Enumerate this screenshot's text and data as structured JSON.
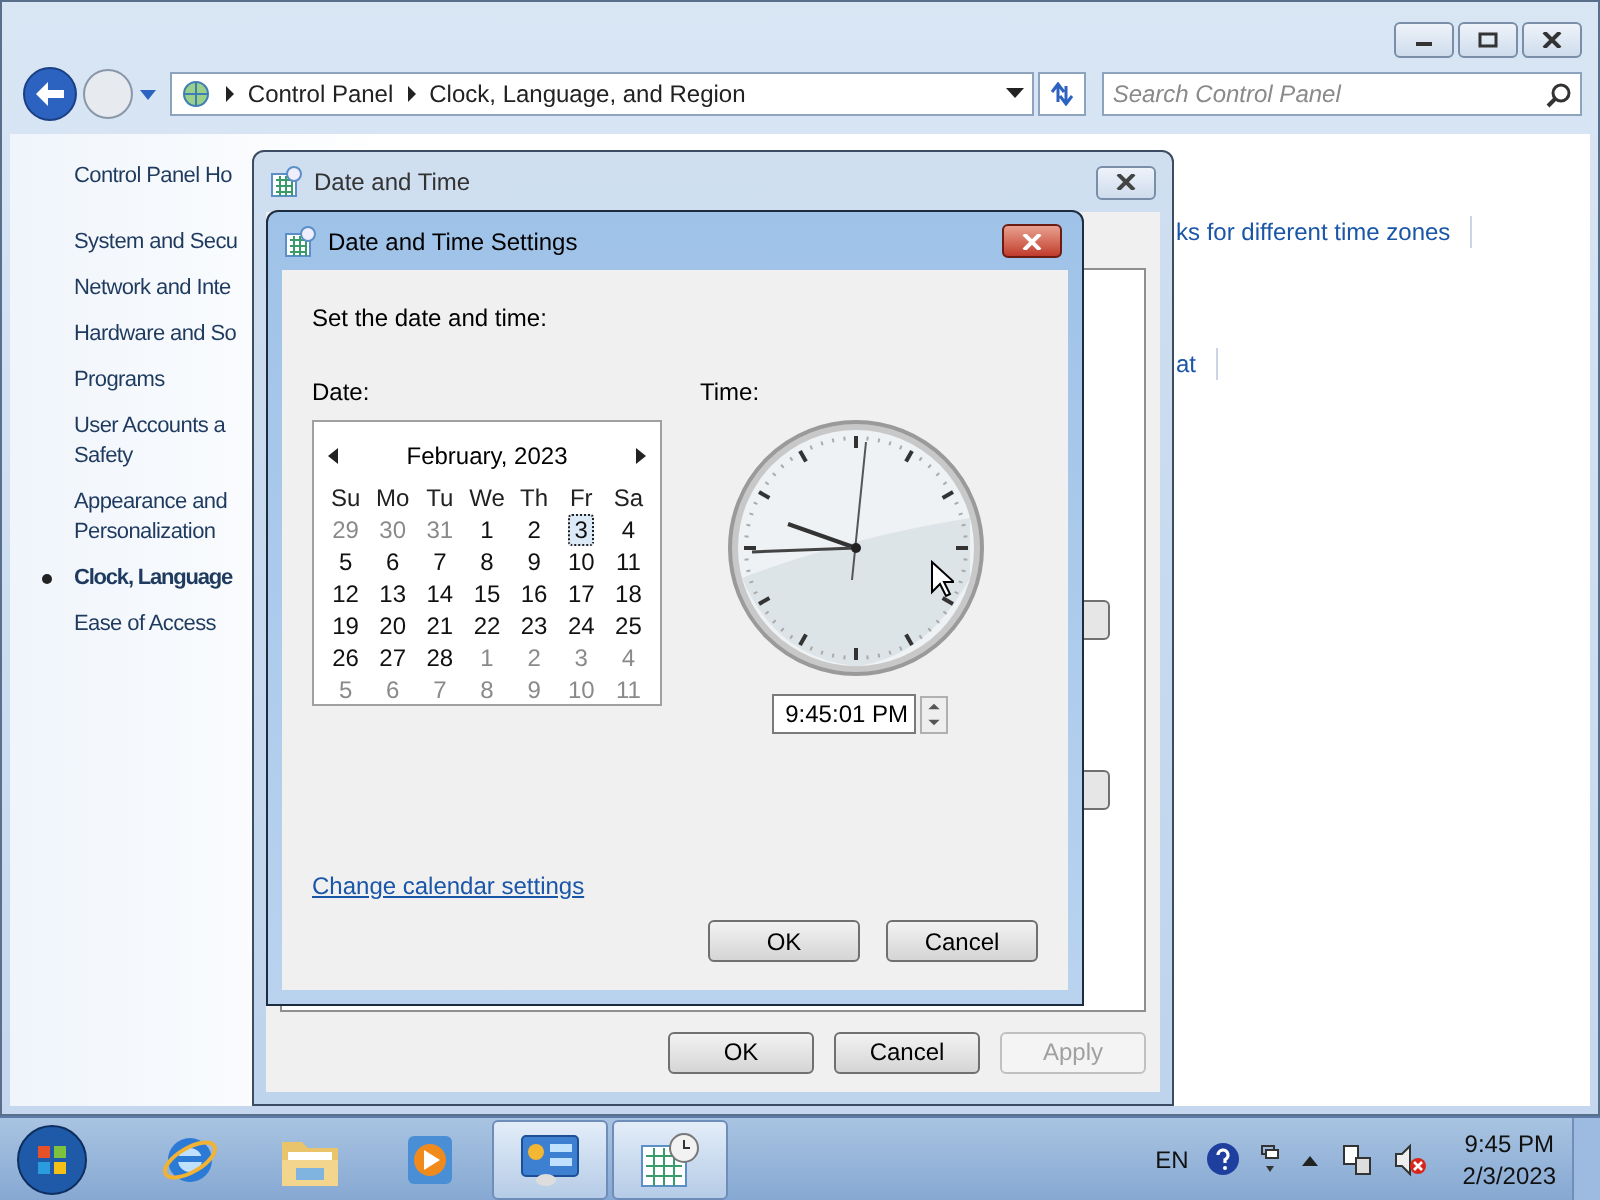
{
  "window": {
    "breadcrumb": [
      "Control Panel",
      "Clock, Language, and Region"
    ],
    "search": {
      "placeholder": "Search Control Panel"
    }
  },
  "sidebar": {
    "items": [
      {
        "lines": [
          "Control Panel Ho"
        ],
        "selected": false
      },
      {
        "lines": [
          "System and Secu"
        ],
        "selected": false
      },
      {
        "lines": [
          "Network and Inte"
        ],
        "selected": false
      },
      {
        "lines": [
          "Hardware and So"
        ],
        "selected": false
      },
      {
        "lines": [
          "Programs"
        ],
        "selected": false
      },
      {
        "lines": [
          "User Accounts a",
          "Safety"
        ],
        "selected": false
      },
      {
        "lines": [
          "Appearance and",
          "Personalization"
        ],
        "selected": false
      },
      {
        "lines": [
          "Clock, Language"
        ],
        "selected": true
      },
      {
        "lines": [
          "Ease of Access"
        ],
        "selected": false
      }
    ]
  },
  "content": {
    "links": [
      "ks for different time zones",
      "at"
    ]
  },
  "date_time_window": {
    "title": "Date and Time",
    "buttons": [
      {
        "label": "OK",
        "disabled": false
      },
      {
        "label": "Cancel",
        "disabled": false
      },
      {
        "label": "Apply",
        "disabled": true
      }
    ]
  },
  "settings_dialog": {
    "title": "Date and Time Settings",
    "instruction": "Set the date and time:",
    "date_label": "Date:",
    "time_label": "Time:",
    "time": "9:45:01 PM",
    "link": "Change calendar settings",
    "buttons": [
      "OK",
      "Cancel"
    ],
    "calendar": {
      "month": "February, 2023",
      "weekdays": [
        "Su",
        "Mo",
        "Tu",
        "We",
        "Th",
        "Fr",
        "Sa"
      ],
      "days": [
        {
          "day": "29",
          "muted": true,
          "selected": false
        },
        {
          "day": "30",
          "muted": true,
          "selected": false
        },
        {
          "day": "31",
          "muted": true,
          "selected": false
        },
        {
          "day": "1",
          "muted": false,
          "selected": false
        },
        {
          "day": "2",
          "muted": false,
          "selected": false
        },
        {
          "day": "3",
          "muted": false,
          "selected": true
        },
        {
          "day": "4",
          "muted": false,
          "selected": false
        },
        {
          "day": "5",
          "muted": false,
          "selected": false
        },
        {
          "day": "6",
          "muted": false,
          "selected": false
        },
        {
          "day": "7",
          "muted": false,
          "selected": false
        },
        {
          "day": "8",
          "muted": false,
          "selected": false
        },
        {
          "day": "9",
          "muted": false,
          "selected": false
        },
        {
          "day": "10",
          "muted": false,
          "selected": false
        },
        {
          "day": "11",
          "muted": false,
          "selected": false
        },
        {
          "day": "12",
          "muted": false,
          "selected": false
        },
        {
          "day": "13",
          "muted": false,
          "selected": false
        },
        {
          "day": "14",
          "muted": false,
          "selected": false
        },
        {
          "day": "15",
          "muted": false,
          "selected": false
        },
        {
          "day": "16",
          "muted": false,
          "selected": false
        },
        {
          "day": "17",
          "muted": false,
          "selected": false
        },
        {
          "day": "18",
          "muted": false,
          "selected": false
        },
        {
          "day": "19",
          "muted": false,
          "selected": false
        },
        {
          "day": "20",
          "muted": false,
          "selected": false
        },
        {
          "day": "21",
          "muted": false,
          "selected": false
        },
        {
          "day": "22",
          "muted": false,
          "selected": false
        },
        {
          "day": "23",
          "muted": false,
          "selected": false
        },
        {
          "day": "24",
          "muted": false,
          "selected": false
        },
        {
          "day": "25",
          "muted": false,
          "selected": false
        },
        {
          "day": "26",
          "muted": false,
          "selected": false
        },
        {
          "day": "27",
          "muted": false,
          "selected": false
        },
        {
          "day": "28",
          "muted": false,
          "selected": false
        },
        {
          "day": "1",
          "muted": true,
          "selected": false
        },
        {
          "day": "2",
          "muted": true,
          "selected": false
        },
        {
          "day": "3",
          "muted": true,
          "selected": false
        },
        {
          "day": "4",
          "muted": true,
          "selected": false
        },
        {
          "day": "5",
          "muted": true,
          "selected": false
        },
        {
          "day": "6",
          "muted": true,
          "selected": false
        },
        {
          "day": "7",
          "muted": true,
          "selected": false
        },
        {
          "day": "8",
          "muted": true,
          "selected": false
        },
        {
          "day": "9",
          "muted": true,
          "selected": false
        },
        {
          "day": "10",
          "muted": true,
          "selected": false
        },
        {
          "day": "11",
          "muted": true,
          "selected": false
        }
      ]
    }
  },
  "taskbar": {
    "apps": [
      {
        "kind": "browser",
        "active": false
      },
      {
        "kind": "folder",
        "active": false
      },
      {
        "kind": "media",
        "active": false
      },
      {
        "kind": "control",
        "active": true
      },
      {
        "kind": "calendar",
        "active": true
      }
    ],
    "language": "EN",
    "time": "9:45 PM",
    "date": "2/3/2023"
  }
}
